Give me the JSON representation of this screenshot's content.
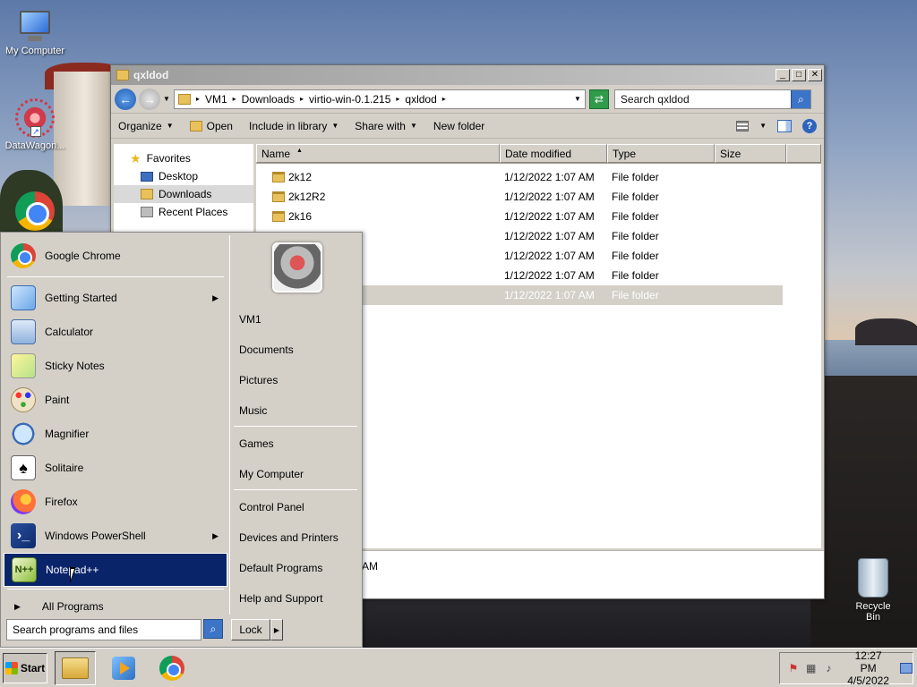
{
  "desktop": {
    "icons": [
      {
        "label": "My Computer"
      },
      {
        "label": "DataWagon..."
      },
      {
        "label": ""
      }
    ],
    "recycle_bin": "Recycle Bin"
  },
  "explorer": {
    "title": "qxldod",
    "breadcrumbs": [
      "VM1",
      "Downloads",
      "virtio-win-0.1.215",
      "qxldod"
    ],
    "search_placeholder": "Search qxldod",
    "toolbar": {
      "organize": "Organize",
      "open": "Open",
      "include": "Include in library",
      "share": "Share with",
      "new_folder": "New folder"
    },
    "nav": {
      "favorites": "Favorites",
      "desktop": "Desktop",
      "downloads": "Downloads",
      "recent": "Recent Places"
    },
    "columns": {
      "name": "Name",
      "date": "Date modified",
      "type": "Type",
      "size": "Size"
    },
    "rows": [
      {
        "name": "2k12",
        "date": "1/12/2022 1:07 AM",
        "type": "File folder"
      },
      {
        "name": "2k12R2",
        "date": "1/12/2022 1:07 AM",
        "type": "File folder"
      },
      {
        "name": "2k16",
        "date": "1/12/2022 1:07 AM",
        "type": "File folder"
      },
      {
        "name": "",
        "date": "1/12/2022 1:07 AM",
        "type": "File folder"
      },
      {
        "name": "",
        "date": "1/12/2022 1:07 AM",
        "type": "File folder"
      },
      {
        "name": "",
        "date": "1/12/2022 1:07 AM",
        "type": "File folder"
      },
      {
        "name": "",
        "date": "1/12/2022 1:07 AM",
        "type": "File folder"
      }
    ],
    "details_text": "AM"
  },
  "start_menu": {
    "pinned": [
      {
        "label": "Google Chrome"
      }
    ],
    "programs": [
      {
        "label": "Getting Started"
      },
      {
        "label": "Calculator"
      },
      {
        "label": "Sticky Notes"
      },
      {
        "label": "Paint"
      },
      {
        "label": "Magnifier"
      },
      {
        "label": "Solitaire"
      },
      {
        "label": "Firefox"
      },
      {
        "label": "Windows PowerShell"
      },
      {
        "label": "Notepad++"
      }
    ],
    "all_programs": "All Programs",
    "search_placeholder": "Search programs and files",
    "right": {
      "user": "VM1",
      "documents": "Documents",
      "pictures": "Pictures",
      "music": "Music",
      "games": "Games",
      "computer": "My Computer",
      "control_panel": "Control Panel",
      "devices": "Devices and Printers",
      "default_programs": "Default Programs",
      "help": "Help and Support"
    },
    "lock": "Lock"
  },
  "taskbar": {
    "start": "Start",
    "time": "12:27 PM",
    "date": "4/5/2022"
  }
}
